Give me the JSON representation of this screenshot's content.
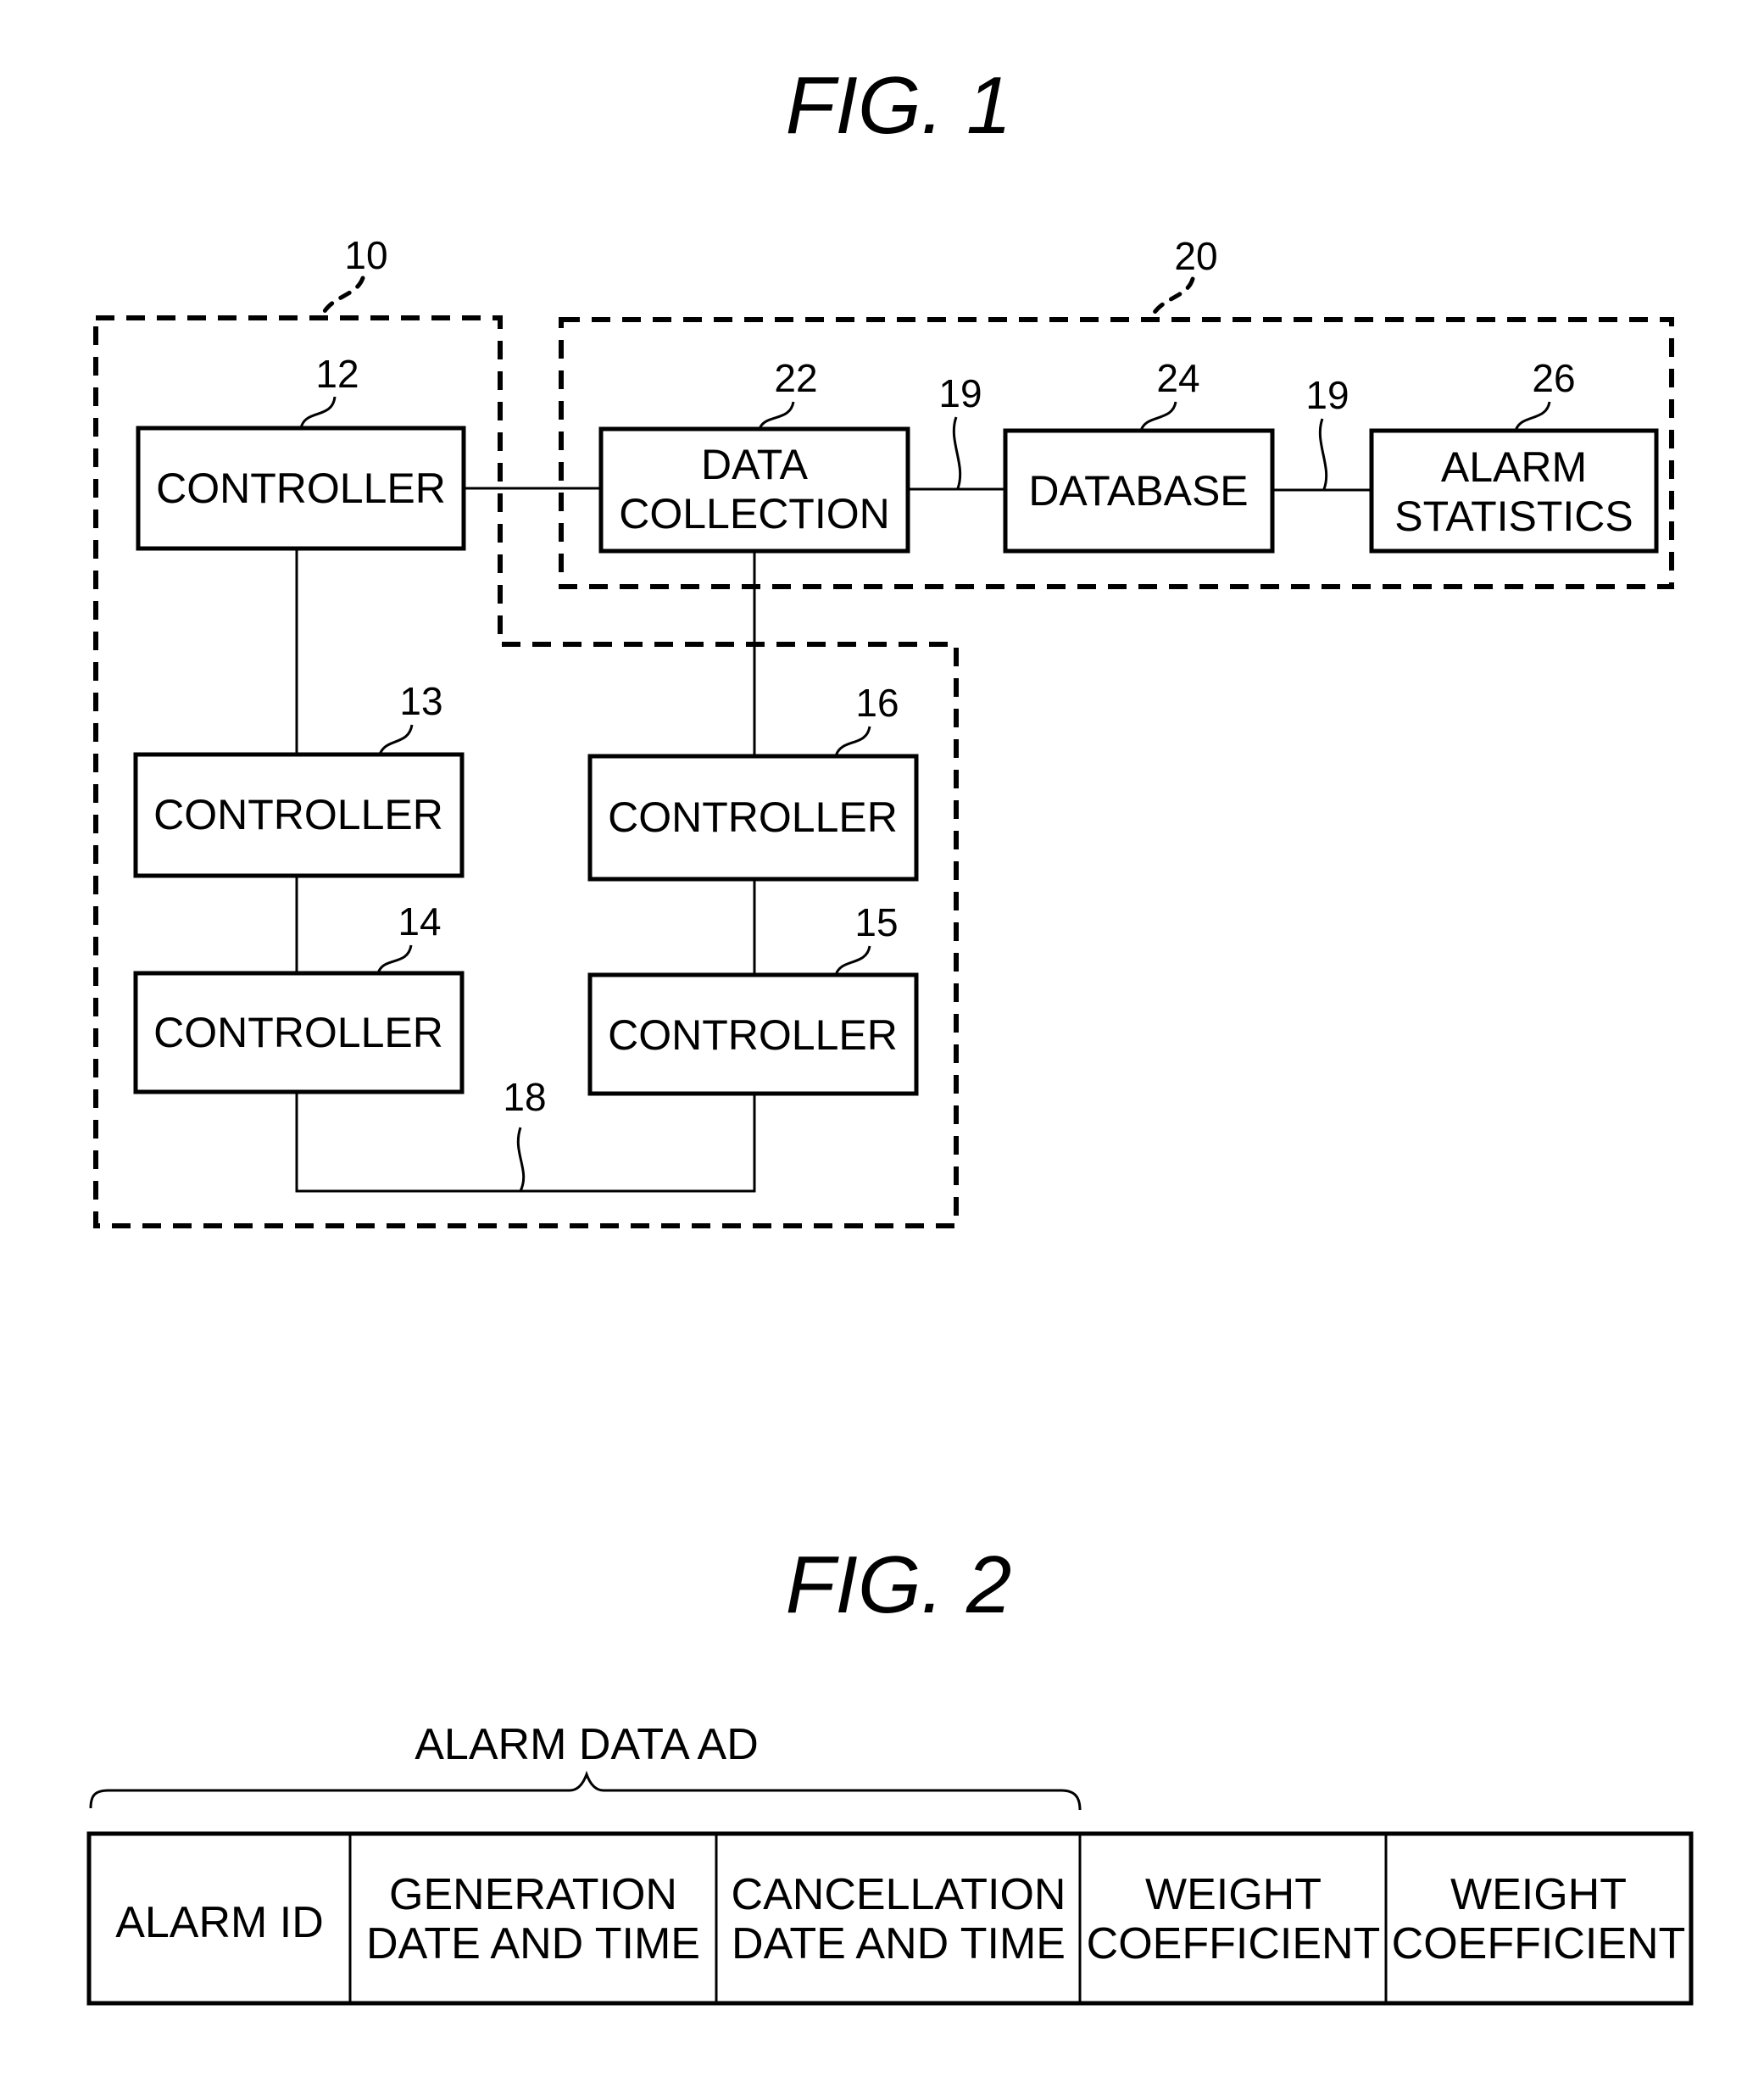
{
  "fig1": {
    "title": "FIG. 1",
    "groups": [
      {
        "ref": "10"
      },
      {
        "ref": "20"
      }
    ],
    "blocks": [
      {
        "ref": "12",
        "lines": [
          "CONTROLLER"
        ]
      },
      {
        "ref": "13",
        "lines": [
          "CONTROLLER"
        ]
      },
      {
        "ref": "14",
        "lines": [
          "CONTROLLER"
        ]
      },
      {
        "ref": "16",
        "lines": [
          "CONTROLLER"
        ]
      },
      {
        "ref": "15",
        "lines": [
          "CONTROLLER"
        ]
      },
      {
        "ref": "22",
        "lines": [
          "DATA",
          "COLLECTION"
        ]
      },
      {
        "ref": "24",
        "lines": [
          "DATABASE"
        ]
      },
      {
        "ref": "26",
        "lines": [
          "ALARM",
          "STATISTICS"
        ]
      }
    ],
    "links": [
      {
        "ref": "19"
      },
      {
        "ref": "19"
      },
      {
        "ref": "18"
      }
    ]
  },
  "fig2": {
    "title": "FIG. 2",
    "brace_label": "ALARM DATA AD",
    "cells": [
      {
        "lines": [
          "ALARM ID"
        ]
      },
      {
        "lines": [
          "GENERATION",
          "DATE AND TIME"
        ]
      },
      {
        "lines": [
          "CANCELLATION",
          "DATE AND TIME"
        ]
      },
      {
        "lines": [
          "WEIGHT",
          "COEFFICIENT"
        ]
      },
      {
        "lines": [
          "WEIGHT",
          "COEFFICIENT"
        ]
      }
    ]
  }
}
